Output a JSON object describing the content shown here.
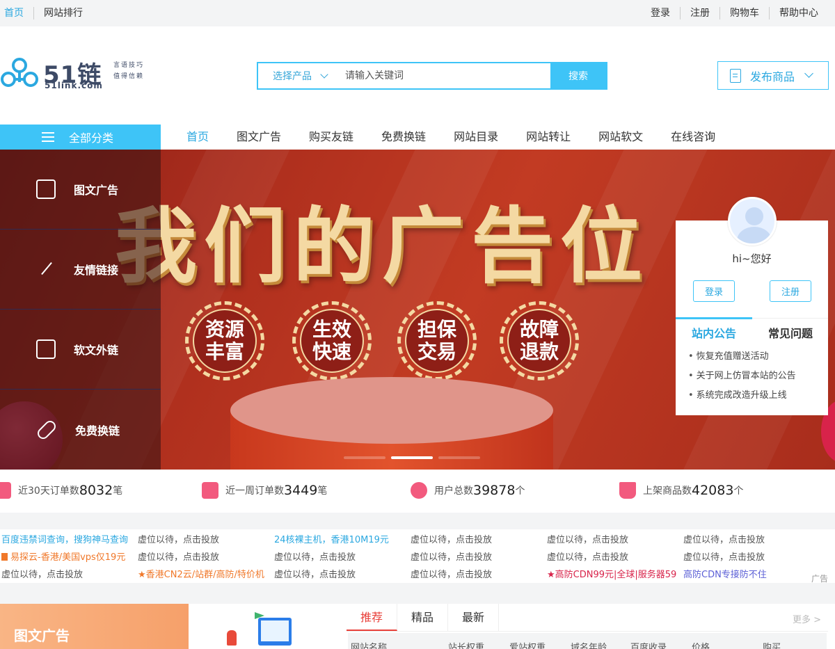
{
  "topbar": {
    "left": [
      "首页",
      "网站排行"
    ],
    "right": [
      "登录",
      "注册",
      "购物车",
      "帮助中心"
    ]
  },
  "logo": {
    "brand": "51链",
    "domain": "51link.com",
    "slogan": "言语技巧值得信赖"
  },
  "search": {
    "select_label": "选择产品",
    "placeholder": "请输入关键词",
    "button": "搜索"
  },
  "publish_button": "发布商品",
  "nav": {
    "category_label": "全部分类",
    "links": [
      "首页",
      "图文广告",
      "购买友链",
      "免费换链",
      "网站目录",
      "网站转让",
      "网站软文",
      "在线咨询"
    ]
  },
  "categories": [
    {
      "label": "图文广告",
      "icon": "image-icon"
    },
    {
      "label": "友情链接",
      "icon": "link-icon"
    },
    {
      "label": "软文外链",
      "icon": "document-icon"
    },
    {
      "label": "免费换链",
      "icon": "chain-icon"
    }
  ],
  "banner": {
    "heading": "我们的广告位",
    "badges": [
      {
        "line1": "资源",
        "line2": "丰富"
      },
      {
        "line1": "生效",
        "line2": "快速"
      },
      {
        "line1": "担保",
        "line2": "交易"
      },
      {
        "line1": "故障",
        "line2": "退款"
      }
    ],
    "slides_total": 3,
    "slide_active": 2
  },
  "login_box": {
    "greeting": "hi~您好",
    "login": "登录",
    "register": "注册",
    "tab_notice": "站内公告",
    "tab_faq": "常见问题",
    "notices": [
      "恢复充值赠送活动",
      "关于网上仿冒本站的公告",
      "系统完成改造升级上线"
    ]
  },
  "stats": [
    {
      "label": "近30天订单数",
      "value": "8032",
      "unit": "笔"
    },
    {
      "label": "近一周订单数",
      "value": "3449",
      "unit": "笔"
    },
    {
      "label": "用户总数",
      "value": "39878",
      "unit": "个"
    },
    {
      "label": "上架商品数",
      "value": "42083",
      "unit": "个"
    }
  ],
  "ads": {
    "rows": [
      [
        "百度违禁词查询，搜狗神马查询",
        "虚位以待，点击投放",
        "24核裸主机，香港10M19元",
        "虚位以待，点击投放",
        "虚位以待，点击投放",
        "虚位以待，点击投放"
      ],
      [
        "易探云-香港/美国vps仅19元",
        "虚位以待，点击投放",
        "虚位以待，点击投放",
        "虚位以待，点击投放",
        "虚位以待，点击投放",
        "虚位以待，点击投放"
      ],
      [
        "虚位以待，点击投放",
        "★香港CN2云/站群/高防/特价机",
        "虚位以待，点击投放",
        "虚位以待，点击投放",
        "★高防CDN99元|全球|服务器59",
        "高防CDN专接防不住"
      ]
    ],
    "tag": "广告"
  },
  "promo_label": "图文广告",
  "recommend": {
    "tabs": [
      "推荐",
      "精品",
      "最新"
    ],
    "more": "更多 >",
    "columns": [
      "网站名称",
      "站长权重",
      "爱站权重",
      "域名年龄",
      "百度收录",
      "价格",
      "购买"
    ]
  },
  "colors": {
    "accent": "#3ec4f7",
    "link": "#2ba8e0",
    "banner_red": "#b0301e",
    "gold": "#f4d9a3",
    "active_tab": "#e8403a"
  }
}
